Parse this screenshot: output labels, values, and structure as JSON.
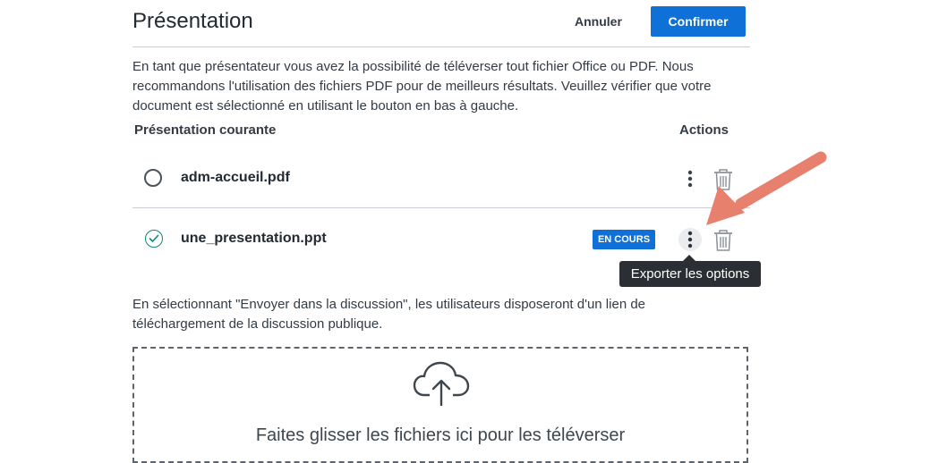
{
  "modal": {
    "title": "Présentation",
    "cancel_label": "Annuler",
    "confirm_label": "Confirmer"
  },
  "intro_text": "En tant que présentateur vous avez la possibilité de téléverser tout fichier Office ou PDF. Nous recommandons l'utilisation des fichiers PDF pour de meilleurs résultats. Veuillez vérifier que votre document est sélectionné en utilisant le bouton en bas à gauche.",
  "columns": {
    "current": "Présentation courante",
    "actions": "Actions"
  },
  "files": [
    {
      "name": "adm-accueil.pdf",
      "selected": false
    },
    {
      "name": "une_presentation.ppt",
      "selected": true,
      "badge": "EN COURS"
    }
  ],
  "tooltip": "Exporter les options",
  "note_text": "En sélectionnant \"Envoyer dans la discussion\", les utilisateurs disposeront d'un lien de téléchargement de la discussion publique.",
  "dropzone": {
    "text": "Faites glisser les fichiers ici pour les téléverser",
    "icon": "cloud-upload-icon"
  },
  "colors": {
    "primary": "#0f70d7",
    "check": "#0f8a6e",
    "tooltip_bg": "#2b2f33",
    "annotation_arrow": "#e8806e"
  }
}
